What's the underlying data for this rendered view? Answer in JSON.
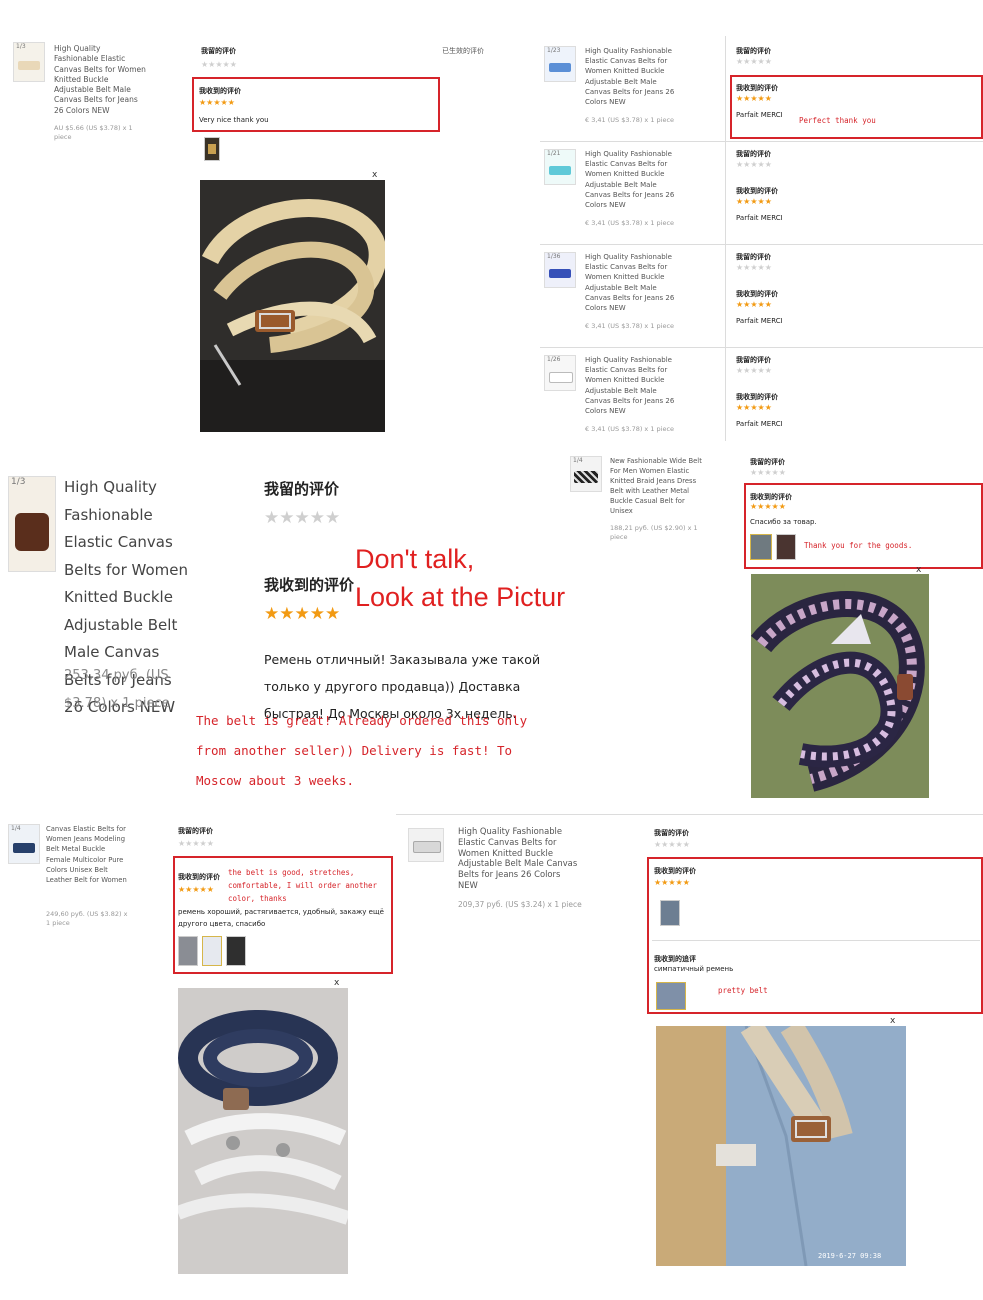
{
  "product_short_title": "High Quality Fashionable Elastic Canvas Belts for Women Knitted Buckle Adjustable Belt Male Canvas Belts for Jeans 26 Colors NEW",
  "labels": {
    "my_review": "我留的评价",
    "received_review": "我收到的评价",
    "followup_review": "我收到的追评",
    "active_reviews": "已生效的评价",
    "close": "x",
    "stars_full": "★★★★★"
  },
  "panel_a": {
    "thumb_index": "1/3",
    "title": "High Quality Fashionable Elastic Canvas Belts for Women Knitted Buckle Adjustable Belt Male Canvas Belts for Jeans 26 Colors NEW",
    "price": "AU $5.66 (US $3.78) x 1 piece",
    "review_text": "Very nice thank you"
  },
  "panel_b": {
    "rows": [
      {
        "thumb_index": "1/23",
        "price": "€ 3,41 (US $3.78) x 1 piece",
        "review": "Parfait MERCI",
        "translation": "Perfect thank you"
      },
      {
        "thumb_index": "1/21",
        "price": "€ 3,41 (US $3.78) x 1 piece",
        "review": "Parfait MERCI",
        "translation": ""
      },
      {
        "thumb_index": "1/36",
        "price": "€ 3,41 (US $3.78) x 1 piece",
        "review": "Parfait MERCI",
        "translation": ""
      },
      {
        "thumb_index": "1/26",
        "price": "€ 3,41 (US $3.78) x 1 piece",
        "review": "Parfait MERCI",
        "translation": ""
      }
    ]
  },
  "panel_c": {
    "thumb_index": "1/3",
    "title": "High Quality Fashionable Elastic Canvas Belts for Women Knitted Buckle Adjustable Belt Male Canvas Belts for Jeans 26 Colors NEW",
    "price": "253,34 руб. (US $3.78) x 1 piece",
    "review_ru": "Ремень отличный! Заказывала уже такой только у другого продавца)) Доставка быстрая! До Москвы около 3х недель.",
    "translation": "The belt is great! Already ordered this only from another seller)) Delivery is fast! To Moscow about 3 weeks."
  },
  "tagline": {
    "line1": "Don't talk,",
    "line2": "Look at the Picture",
    "color": "#e02020"
  },
  "panel_d": {
    "thumb_index": "1/4",
    "title": "New Fashionable Wide Belt For Men Women Elastic Knitted Braid Jeans Dress Belt with Leather Metal Buckle Casual Belt for Unisex",
    "price": "188,21 руб. (US $2.90) x 1 piece",
    "review_ru": "Спасибо за товар.",
    "translation": "Thank you for the goods."
  },
  "panel_e": {
    "thumb_index": "1/4",
    "title": "Canvas Elastic Belts for Women Jeans Modeling Belt Metal Buckle Female Multicolor Pure Colors Unisex Belt Leather Belt for Women",
    "price": "249,60 руб. (US $3.82) x 1 piece",
    "review_ru": "ремень хороший, растягивается, удобный, закажу ещё другого цвета, спасибо",
    "translation": "the belt is good, stretches, comfortable, I will order another color, thanks"
  },
  "panel_f": {
    "title": "High Quality Fashionable Elastic Canvas Belts for Women Knitted Buckle Adjustable Belt Male Canvas Belts for Jeans 26 Colors NEW",
    "price": "209,37 руб. (US $3.24) x 1 piece",
    "followup_ru": "симпатичный ремень",
    "translation": "pretty belt",
    "photo_timestamp": "2019-6-27 09:38"
  },
  "colors": {
    "accent_red": "#d6242a",
    "star_orange": "#f29a13"
  }
}
